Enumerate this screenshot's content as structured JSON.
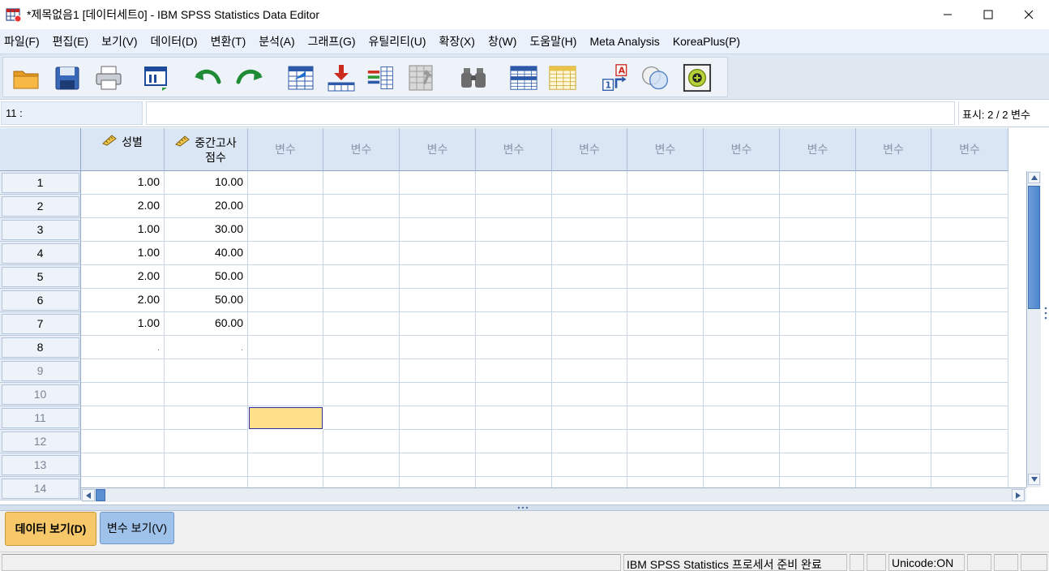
{
  "window": {
    "title": "*제목없음1 [데이터세트0] - IBM SPSS Statistics Data Editor",
    "minimize_glyph": "—",
    "maximize_glyph": "☐",
    "close_glyph": "✕"
  },
  "menu": [
    "파일(F)",
    "편집(E)",
    "보기(V)",
    "데이터(D)",
    "변환(T)",
    "분석(A)",
    "그래프(G)",
    "유틸리티(U)",
    "확장(X)",
    "창(W)",
    "도움말(H)",
    "Meta Analysis",
    "KoreaPlus(P)"
  ],
  "toolbar": {
    "icons": [
      "open-folder-icon",
      "save-icon",
      "print-icon",
      "recall-dialog-icon",
      "undo-icon",
      "redo-icon",
      "goto-case-icon",
      "goto-variable-icon",
      "variables-icon",
      "run-descriptives-icon",
      "find-icon",
      "insert-cases-icon",
      "insert-variable-icon",
      "value-labels-icon",
      "use-sets-icon",
      "extension-icon"
    ]
  },
  "editor": {
    "cell_ref": "11 :",
    "cell_value": "",
    "show_count": "표시: 2 / 2 변수"
  },
  "columns": [
    {
      "label": "성별",
      "label2": "",
      "is_variable": true
    },
    {
      "label": "중간고사",
      "label2": "점수",
      "is_variable": true
    },
    {
      "label": "변수",
      "label2": "",
      "is_variable": false
    },
    {
      "label": "변수",
      "label2": "",
      "is_variable": false
    },
    {
      "label": "변수",
      "label2": "",
      "is_variable": false
    },
    {
      "label": "변수",
      "label2": "",
      "is_variable": false
    },
    {
      "label": "변수",
      "label2": "",
      "is_variable": false
    },
    {
      "label": "변수",
      "label2": "",
      "is_variable": false
    },
    {
      "label": "변수",
      "label2": "",
      "is_variable": false
    },
    {
      "label": "변수",
      "label2": "",
      "is_variable": false
    },
    {
      "label": "변수",
      "label2": "",
      "is_variable": false
    },
    {
      "label": "변수",
      "label2": "",
      "is_variable": false
    }
  ],
  "rows": [
    {
      "num": "1",
      "values": [
        "1.00",
        "10.00"
      ]
    },
    {
      "num": "2",
      "values": [
        "2.00",
        "20.00"
      ]
    },
    {
      "num": "3",
      "values": [
        "1.00",
        "30.00"
      ]
    },
    {
      "num": "4",
      "values": [
        "1.00",
        "40.00"
      ]
    },
    {
      "num": "5",
      "values": [
        "2.00",
        "50.00"
      ]
    },
    {
      "num": "6",
      "values": [
        "2.00",
        "50.00"
      ]
    },
    {
      "num": "7",
      "values": [
        "1.00",
        "60.00"
      ]
    },
    {
      "num": "8",
      "values": [
        ".",
        "."
      ]
    },
    {
      "num": "9",
      "values": [
        "",
        ""
      ]
    },
    {
      "num": "10",
      "values": [
        "",
        ""
      ]
    },
    {
      "num": "11",
      "values": [
        "",
        ""
      ]
    },
    {
      "num": "12",
      "values": [
        "",
        ""
      ]
    },
    {
      "num": "13",
      "values": [
        "",
        ""
      ]
    },
    {
      "num": "14",
      "values": [
        "",
        ""
      ]
    }
  ],
  "selected": {
    "row": "11",
    "col": 3
  },
  "tabs": {
    "data_view": "데이터 보기(D)",
    "variable_view": "변수 보기(V)"
  },
  "status": {
    "processor": "IBM SPSS Statistics 프로세서 준비 완료",
    "unicode": "Unicode:ON"
  },
  "colors": {
    "selected_cell": "#ffe08a",
    "active_tab": "#f7c869",
    "inactive_tab": "#9fc2ea",
    "header_bg": "#dbe6f4"
  }
}
